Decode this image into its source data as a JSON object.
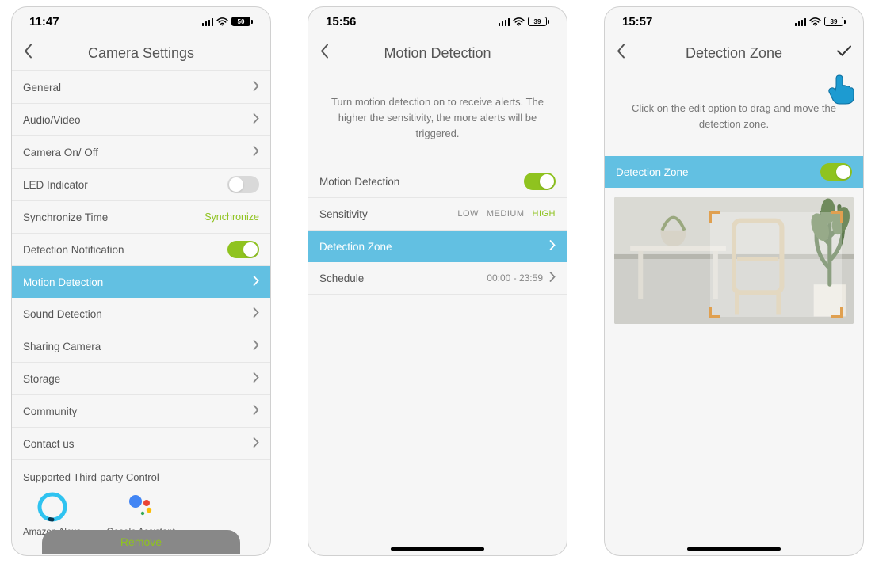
{
  "colors": {
    "accent": "#62c0e2",
    "green": "#8fc31f"
  },
  "screen1": {
    "time": "11:47",
    "battery": "50",
    "title": "Camera Settings",
    "items": [
      {
        "label": "General",
        "type": "nav"
      },
      {
        "label": "Audio/Video",
        "type": "nav"
      },
      {
        "label": "Camera On/ Off",
        "type": "nav"
      },
      {
        "label": "LED Indicator",
        "type": "toggle",
        "on": false
      },
      {
        "label": "Synchronize Time",
        "type": "link",
        "value": "Synchronize"
      },
      {
        "label": "Detection Notification",
        "type": "toggle",
        "on": true
      },
      {
        "label": "Motion Detection",
        "type": "nav",
        "highlight": true
      },
      {
        "label": "Sound Detection",
        "type": "nav"
      },
      {
        "label": "Sharing Camera",
        "type": "nav"
      },
      {
        "label": "Storage",
        "type": "nav"
      },
      {
        "label": "Community",
        "type": "nav"
      },
      {
        "label": "Contact us",
        "type": "nav"
      }
    ],
    "thirdparty_title": "Supported Third-party Control",
    "alexa_label": "Amazon Alexa",
    "google_label": "Google Assistant",
    "remove_label": "Remove"
  },
  "screen2": {
    "time": "15:56",
    "battery": "39",
    "title": "Motion Detection",
    "description": "Turn motion detection on to receive alerts. The higher the sensitivity, the more alerts will be triggered.",
    "motion_label": "Motion Detection",
    "motion_on": true,
    "sensitivity_label": "Sensitivity",
    "sensitivity_options": [
      "LOW",
      "MEDIUM",
      "HIGH"
    ],
    "sensitivity_selected": "HIGH",
    "zone_label": "Detection Zone",
    "schedule_label": "Schedule",
    "schedule_value": "00:00 - 23:59"
  },
  "screen3": {
    "time": "15:57",
    "battery": "39",
    "title": "Detection Zone",
    "description": "Click on the edit option to drag and move the detection zone.",
    "zone_label": "Detection Zone",
    "zone_on": true
  }
}
